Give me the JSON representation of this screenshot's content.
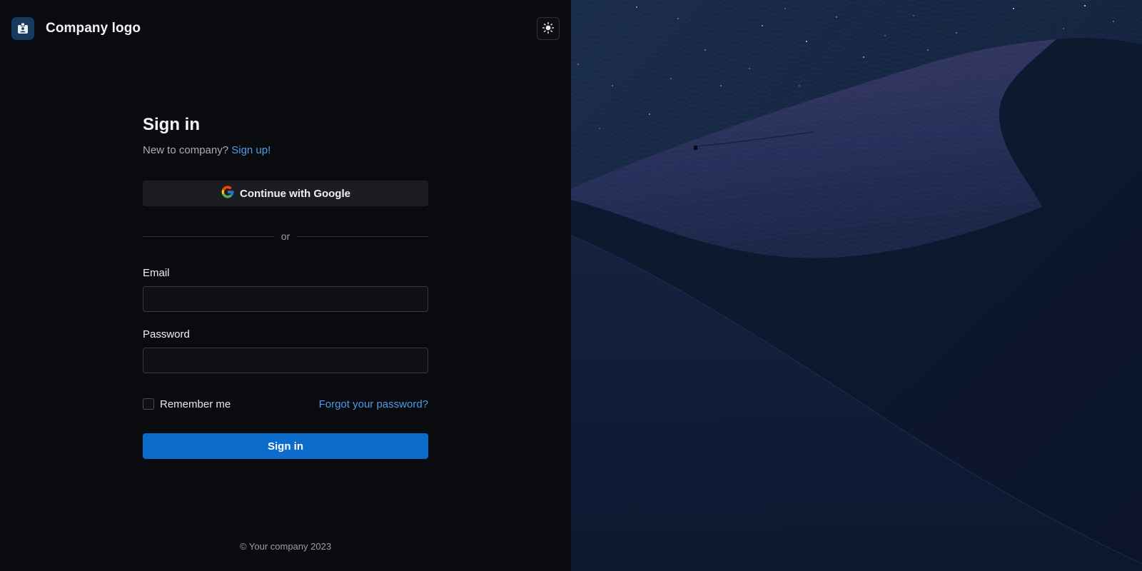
{
  "brand": {
    "name": "Company logo"
  },
  "header": {
    "theme_toggle_icon": "sun-icon"
  },
  "signin_form": {
    "title": "Sign in",
    "subtitle_prefix": "New to company?",
    "signup_link": "Sign up!",
    "google_button_label": "Continue with Google",
    "divider_text": "or",
    "email_label": "Email",
    "email_value": "",
    "email_placeholder": "",
    "password_label": "Password",
    "password_value": "",
    "password_placeholder": "",
    "remember_label": "Remember me",
    "remember_checked": false,
    "forgot_link": "Forgot your password?",
    "submit_label": "Sign in"
  },
  "footer": {
    "text": "© Your company 2023"
  },
  "colors": {
    "accent": "#0c6ccb",
    "link": "#4d9be8",
    "background": "#0a0b0e",
    "panel_button": "#1b1d21"
  },
  "icons": {
    "logo": "id-badge-icon",
    "google": "google-icon",
    "theme": "sun-icon"
  }
}
